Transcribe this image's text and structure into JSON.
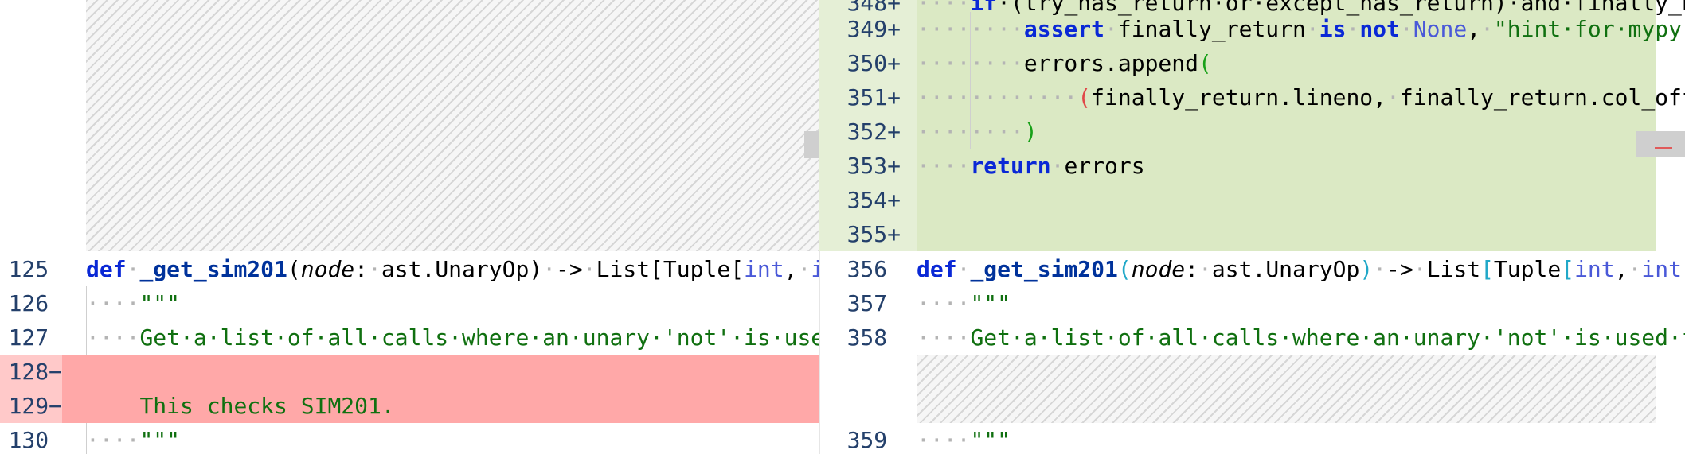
{
  "colors": {
    "removed_line": "#ffa8a8",
    "added_line": "#dbe9c4",
    "keyword": "#0a28d6",
    "string": "#107010",
    "line_number": "#24406b"
  },
  "left": {
    "lines": [
      {
        "num": "125",
        "marker": " ",
        "segments": [
          {
            "t": "def",
            "c": "kw"
          },
          {
            "t": "·",
            "c": "dim"
          },
          {
            "t": "_get_sim201",
            "c": "fn"
          },
          {
            "t": "(",
            "c": ""
          },
          {
            "t": "node",
            "c": "param"
          },
          {
            "t": ":",
            "c": ""
          },
          {
            "t": "·",
            "c": "dim"
          },
          {
            "t": "ast.UnaryOp)",
            "c": ""
          },
          {
            "t": "·",
            "c": "dim"
          },
          {
            "t": "->",
            "c": ""
          },
          {
            "t": "·",
            "c": "dim"
          },
          {
            "t": "List[Tuple[",
            "c": ""
          },
          {
            "t": "int",
            "c": "bi"
          },
          {
            "t": ",",
            "c": ""
          },
          {
            "t": "·",
            "c": "dim"
          },
          {
            "t": "int",
            "c": "bi"
          },
          {
            "t": ",",
            "c": ""
          }
        ]
      },
      {
        "num": "126",
        "marker": " ",
        "segments": [
          {
            "t": "····",
            "c": "dim"
          },
          {
            "t": "\"\"\"",
            "c": "str"
          }
        ]
      },
      {
        "num": "127",
        "marker": " ",
        "segments": [
          {
            "t": "····",
            "c": "dim"
          },
          {
            "t": "Get·a·list·of·all·calls·where·an·unary·'not'·is·used·fo",
            "c": "str"
          }
        ]
      },
      {
        "num": "128",
        "marker": "−",
        "segments": []
      },
      {
        "num": "129",
        "marker": "−",
        "segments": [
          {
            "t": "    ",
            "c": ""
          },
          {
            "t": "This checks SIM201.",
            "c": "str"
          }
        ]
      },
      {
        "num": "130",
        "marker": " ",
        "segments": [
          {
            "t": "····",
            "c": "dim"
          },
          {
            "t": "\"\"\"",
            "c": "str"
          }
        ]
      }
    ]
  },
  "right": {
    "lines": [
      {
        "num": "348",
        "marker": "+",
        "segments": [
          {
            "t": "····",
            "c": "dim"
          },
          {
            "t": "if",
            "c": "kw"
          },
          {
            "t": "·(try_has_return·or·except_has_return)·and·finally_ha",
            "c": ""
          }
        ]
      },
      {
        "num": "349",
        "marker": "+",
        "segments": [
          {
            "t": "········",
            "c": "dim"
          },
          {
            "t": "assert",
            "c": "kw"
          },
          {
            "t": "·",
            "c": "dim"
          },
          {
            "t": "finally_return",
            "c": ""
          },
          {
            "t": "·",
            "c": "dim"
          },
          {
            "t": "is",
            "c": "kw"
          },
          {
            "t": "·",
            "c": "dim"
          },
          {
            "t": "not",
            "c": "kw"
          },
          {
            "t": "·",
            "c": "dim"
          },
          {
            "t": "None",
            "c": "bi"
          },
          {
            "t": ",",
            "c": ""
          },
          {
            "t": "·",
            "c": "dim"
          },
          {
            "t": "\"hint·for·mypy\"",
            "c": "str"
          }
        ]
      },
      {
        "num": "350",
        "marker": "+",
        "segments": [
          {
            "t": "········",
            "c": "dim"
          },
          {
            "t": "errors.append",
            "c": ""
          },
          {
            "t": "(",
            "c": "paren-g"
          }
        ]
      },
      {
        "num": "351",
        "marker": "+",
        "segments": [
          {
            "t": "············",
            "c": "dim"
          },
          {
            "t": "(",
            "c": "paren-r"
          },
          {
            "t": "finally_return.lineno,",
            "c": ""
          },
          {
            "t": "·",
            "c": "dim"
          },
          {
            "t": "finally_return.col_offs",
            "c": ""
          }
        ]
      },
      {
        "num": "352",
        "marker": "+",
        "segments": [
          {
            "t": "········",
            "c": "dim"
          },
          {
            "t": ")",
            "c": "paren-g"
          }
        ]
      },
      {
        "num": "353",
        "marker": "+",
        "segments": [
          {
            "t": "····",
            "c": "dim"
          },
          {
            "t": "return",
            "c": "kw"
          },
          {
            "t": "·",
            "c": "dim"
          },
          {
            "t": "errors",
            "c": ""
          }
        ]
      },
      {
        "num": "354",
        "marker": "+",
        "segments": []
      },
      {
        "num": "355",
        "marker": "+",
        "segments": []
      },
      {
        "num": "356",
        "marker": " ",
        "segments": [
          {
            "t": "def",
            "c": "kw"
          },
          {
            "t": "·",
            "c": "dim"
          },
          {
            "t": "_get_sim201",
            "c": "fn"
          },
          {
            "t": "(",
            "c": "paren-c"
          },
          {
            "t": "node",
            "c": "param"
          },
          {
            "t": ":",
            "c": ""
          },
          {
            "t": "·",
            "c": "dim"
          },
          {
            "t": "ast.UnaryOp",
            "c": ""
          },
          {
            "t": ")",
            "c": "paren-c"
          },
          {
            "t": "·",
            "c": "dim"
          },
          {
            "t": "->",
            "c": ""
          },
          {
            "t": "·",
            "c": "dim"
          },
          {
            "t": "List",
            "c": ""
          },
          {
            "t": "[",
            "c": "paren-c"
          },
          {
            "t": "Tuple",
            "c": ""
          },
          {
            "t": "[",
            "c": "paren-c"
          },
          {
            "t": "int",
            "c": "bi"
          },
          {
            "t": ",",
            "c": ""
          },
          {
            "t": "·",
            "c": "dim"
          },
          {
            "t": "int",
            "c": "bi"
          },
          {
            "t": ",",
            "c": ""
          }
        ]
      },
      {
        "num": "357",
        "marker": " ",
        "segments": [
          {
            "t": "····",
            "c": "dim"
          },
          {
            "t": "\"\"\"",
            "c": "str"
          }
        ]
      },
      {
        "num": "358",
        "marker": " ",
        "segments": [
          {
            "t": "····",
            "c": "dim"
          },
          {
            "t": "Get·a·list·of·all·calls·where·an·unary·'not'·is·used·fo",
            "c": "str"
          }
        ]
      },
      {
        "num": "359",
        "marker": " ",
        "segments": [
          {
            "t": "····",
            "c": "dim"
          },
          {
            "t": "\"\"\"",
            "c": "str"
          }
        ]
      }
    ]
  }
}
